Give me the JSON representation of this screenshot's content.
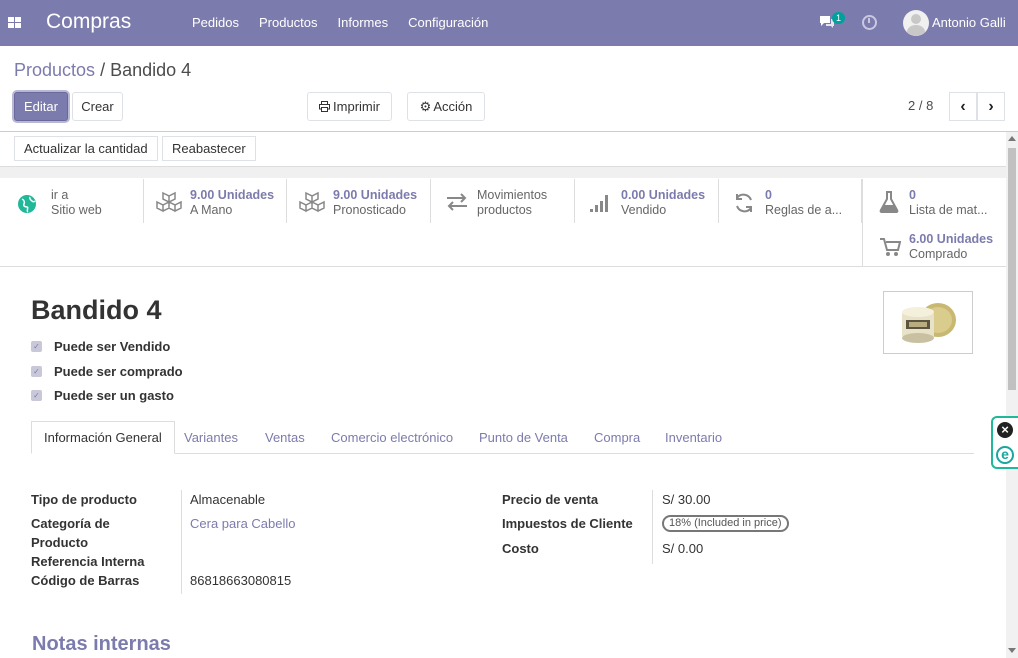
{
  "navbar": {
    "brand": "Compras",
    "menu": [
      "Pedidos",
      "Productos",
      "Informes",
      "Configuración"
    ],
    "chat_badge": "1",
    "user": "Antonio Galli"
  },
  "breadcrumb": {
    "parent": "Productos",
    "separator": "/",
    "current": "Bandido 4"
  },
  "buttons": {
    "edit": "Editar",
    "create": "Crear",
    "print": "Imprimir",
    "action": "Acción"
  },
  "pager": {
    "value": "2 / 8"
  },
  "header_buttons": {
    "update_qty": "Actualizar la cantidad",
    "replenish": "Reabastecer"
  },
  "stat_buttons": [
    {
      "line1": "ir a",
      "line2": "Sitio web",
      "icon": "globe-icon",
      "bold": false
    },
    {
      "line1": "9.00 Unidades",
      "line2": "A Mano",
      "icon": "cubes-icon",
      "bold": true
    },
    {
      "line1": "9.00 Unidades",
      "line2": "Pronosticado",
      "icon": "cubes-icon",
      "bold": true
    },
    {
      "line1": "Movimientos",
      "line2": "productos",
      "icon": "exchange-icon",
      "bold": false
    },
    {
      "line1": "0.00 Unidades",
      "line2": "Vendido",
      "icon": "signal-icon",
      "bold": true
    },
    {
      "line1": "0",
      "line2": "Reglas de a...",
      "icon": "refresh-icon",
      "bold": true
    },
    {
      "line1": "0",
      "line2": "Lista de mat...",
      "icon": "flask-icon",
      "bold": true
    },
    {
      "line1": "6.00 Unidades",
      "line2": "Comprado",
      "icon": "cart-icon",
      "bold": true
    }
  ],
  "product": {
    "name": "Bandido 4",
    "checkboxes": [
      "Puede ser Vendido",
      "Puede ser comprado",
      "Puede ser un gasto"
    ]
  },
  "tabs": [
    "Información General",
    "Variantes",
    "Ventas",
    "Comercio electrónico",
    "Punto de Venta",
    "Compra",
    "Inventario"
  ],
  "fields_left": {
    "type_label": "Tipo de producto",
    "type_value": "Almacenable",
    "category_label_1": "Categoría de",
    "category_label_2": "Producto",
    "category_value": "Cera para Cabello",
    "ref_label": "Referencia Interna",
    "ref_value": "",
    "barcode_label": "Código de Barras",
    "barcode_value": "86818663080815"
  },
  "fields_right": {
    "price_label": "Precio de venta",
    "price_value": "S/ 30.00",
    "tax_label": "Impuestos de Cliente",
    "tax_value": "18% (Included in price)",
    "cost_label": "Costo",
    "cost_value": "S/ 0.00"
  },
  "notes_title": "Notas internas",
  "colors": {
    "brand": "#7c7bad",
    "widget": "#21b799"
  }
}
